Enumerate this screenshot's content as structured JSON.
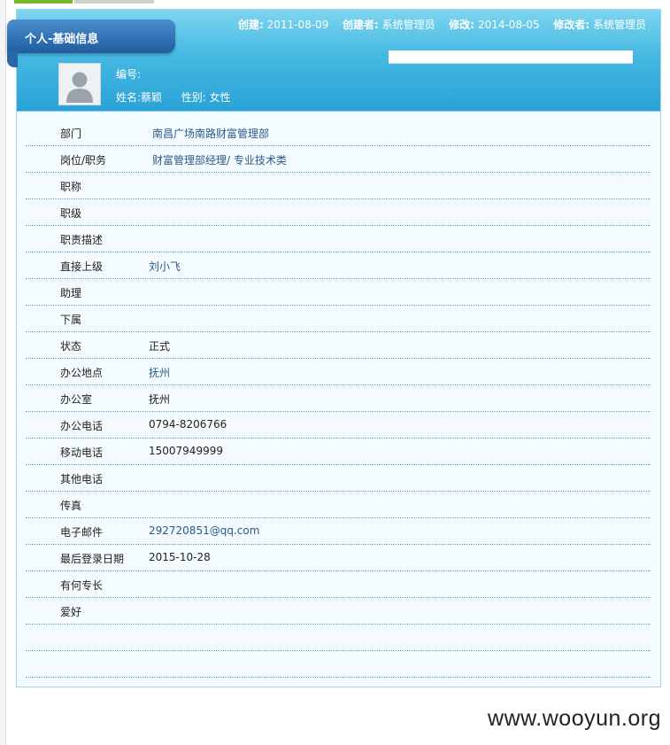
{
  "header": {
    "title": "个人-基础信息",
    "meta": {
      "created_label": "创建:",
      "created_value": "2011-08-09",
      "creator_label": "创建者:",
      "creator_value": "系统管理员",
      "modified_label": "修改:",
      "modified_value": "2014-08-05",
      "modifier_label": "修改者:",
      "modifier_value": "系统管理员"
    },
    "id_label": "编号:",
    "name_label": "姓名:",
    "name_value": "蔡颖",
    "gender_label": "性别:",
    "gender_value": "女性"
  },
  "fields": [
    {
      "label": "部门",
      "value": "南昌广场南路财富管理部"
    },
    {
      "label": "岗位/职务",
      "value": "财富管理部经理/ 专业技术类"
    },
    {
      "label": "职称",
      "value": ""
    },
    {
      "label": "职级",
      "value": ""
    },
    {
      "label": "职责描述",
      "value": ""
    },
    {
      "label": "直接上级",
      "value": "刘小飞"
    },
    {
      "label": "助理",
      "value": ""
    },
    {
      "label": "下属",
      "value": ""
    },
    {
      "label": "状态",
      "value": "正式"
    },
    {
      "label": "办公地点",
      "value": "抚州"
    },
    {
      "label": "办公室",
      "value": "抚州"
    },
    {
      "label": "办公电话",
      "value": "0794-8206766"
    },
    {
      "label": "移动电话",
      "value": "15007949999"
    },
    {
      "label": "其他电话",
      "value": ""
    },
    {
      "label": "传真",
      "value": ""
    },
    {
      "label": "电子邮件",
      "value": "292720851@qq.com"
    },
    {
      "label": "最后登录日期",
      "value": "2015-10-28"
    },
    {
      "label": "有何专长",
      "value": ""
    },
    {
      "label": "爱好",
      "value": ""
    },
    {
      "label": "",
      "value": ""
    },
    {
      "label": "",
      "value": ""
    }
  ],
  "watermark": "www.wooyun.org",
  "colors": {
    "header_gradient_top": "#7fd5ef",
    "header_gradient_bottom": "#2aa2d6",
    "title_tab": "#2f6fb3",
    "link": "#2b5a8a",
    "row_divider": "#5ba9cc",
    "tab_active": "#76b72a"
  },
  "icons": {
    "avatar": "user-silhouette-icon"
  }
}
